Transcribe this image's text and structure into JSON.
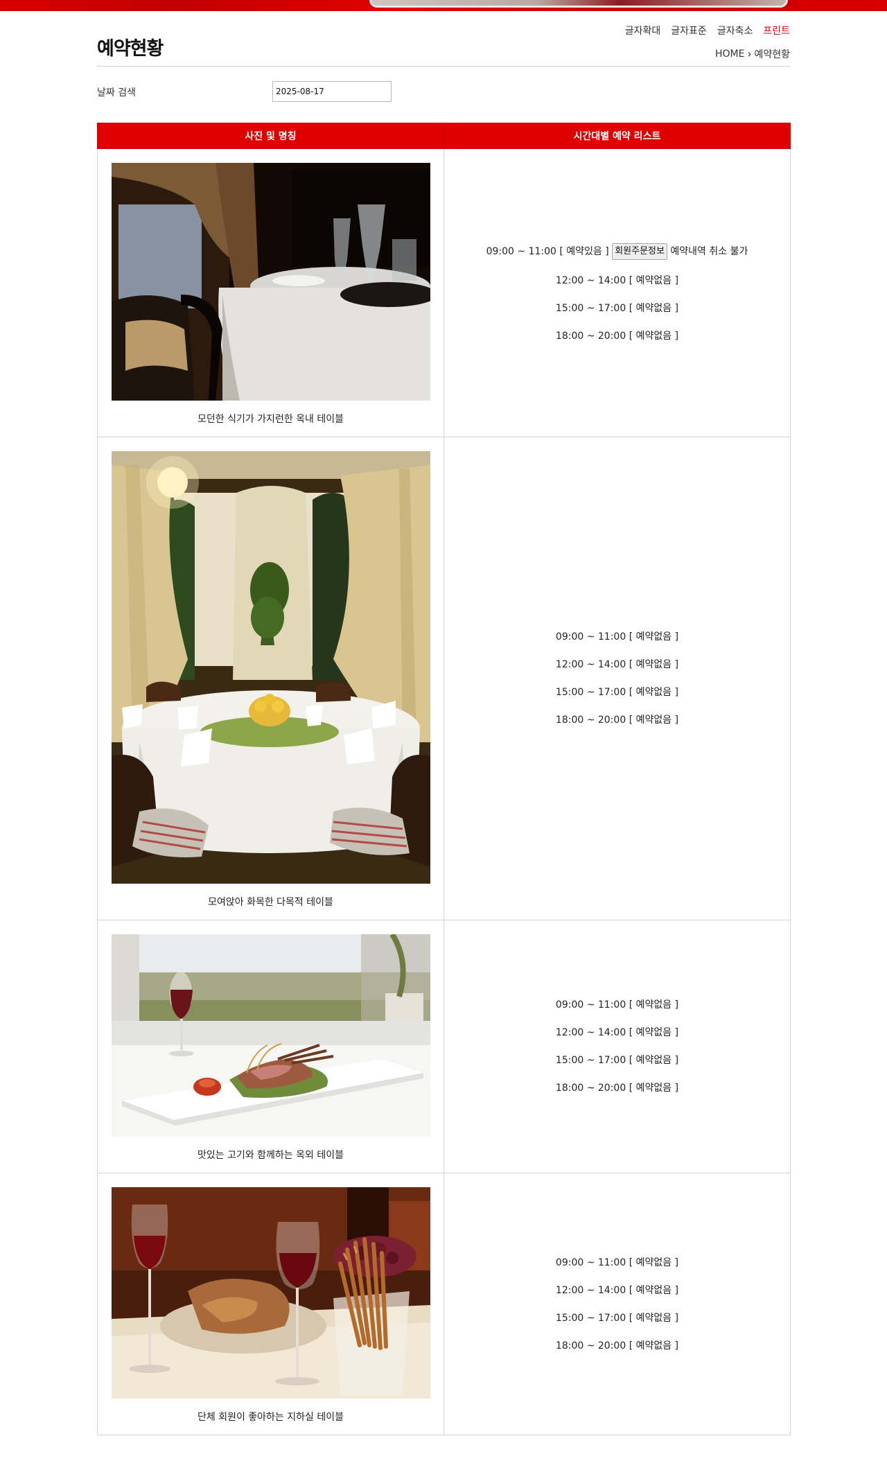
{
  "page": {
    "title": "예약현황",
    "font_tools": [
      "글자확대",
      "글자표준",
      "글자축소",
      "프린트"
    ],
    "breadcrumb": {
      "home": "HOME",
      "current": "예약현황"
    }
  },
  "search": {
    "label": "날짜 검색",
    "date_value": "2025-08-17"
  },
  "table": {
    "headers": [
      "사진 및 명칭",
      "시간대별 예약 리스트"
    ],
    "rows": [
      {
        "caption": "모던한 식기가 가지런한 옥내 테이블",
        "slots": [
          {
            "time": "09:00 ~ 11:00",
            "status": "[ 예약있음 ]",
            "button": "회원주문정보",
            "note": "예약내역 취소 불가"
          },
          {
            "time": "12:00 ~ 14:00",
            "status": "[ 예약없음 ]"
          },
          {
            "time": "15:00 ~ 17:00",
            "status": "[ 예약없음 ]"
          },
          {
            "time": "18:00 ~ 20:00",
            "status": "[ 예약없음 ]"
          }
        ]
      },
      {
        "caption": "모여앉아 화목한 다목적 테이블",
        "slots": [
          {
            "time": "09:00 ~ 11:00",
            "status": "[ 예약없음 ]"
          },
          {
            "time": "12:00 ~ 14:00",
            "status": "[ 예약없음 ]"
          },
          {
            "time": "15:00 ~ 17:00",
            "status": "[ 예약없음 ]"
          },
          {
            "time": "18:00 ~ 20:00",
            "status": "[ 예약없음 ]"
          }
        ]
      },
      {
        "caption": "맛있는 고기와 함께하는 옥외 테이블",
        "slots": [
          {
            "time": "09:00 ~ 11:00",
            "status": "[ 예약없음 ]"
          },
          {
            "time": "12:00 ~ 14:00",
            "status": "[ 예약없음 ]"
          },
          {
            "time": "15:00 ~ 17:00",
            "status": "[ 예약없음 ]"
          },
          {
            "time": "18:00 ~ 20:00",
            "status": "[ 예약없음 ]"
          }
        ]
      },
      {
        "caption": "단체 회원이 좋아하는 지하실 테이블",
        "slots": [
          {
            "time": "09:00 ~ 11:00",
            "status": "[ 예약없음 ]"
          },
          {
            "time": "12:00 ~ 14:00",
            "status": "[ 예약없음 ]"
          },
          {
            "time": "15:00 ~ 17:00",
            "status": "[ 예약없음 ]"
          },
          {
            "time": "18:00 ~ 20:00",
            "status": "[ 예약없음 ]"
          }
        ]
      }
    ]
  },
  "colors": {
    "accent_red": "#e00000",
    "border_gray": "#d3d3d3",
    "print_red": "#d60000"
  }
}
